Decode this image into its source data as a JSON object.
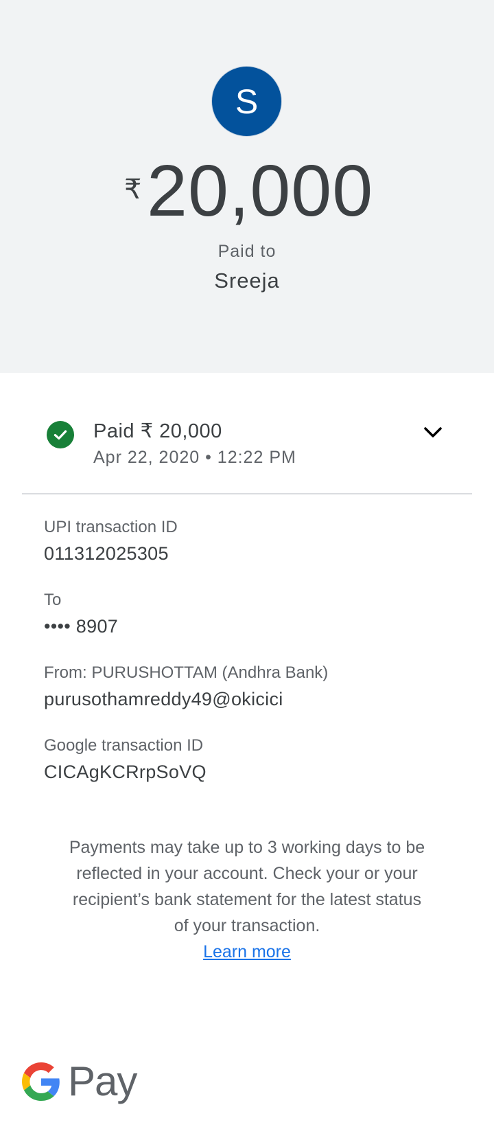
{
  "header": {
    "avatar_initial": "S",
    "currency_symbol": "₹",
    "amount": "20,000",
    "paid_to_label": "Paid to",
    "payee_name": "Sreeja"
  },
  "status": {
    "title": "Paid ₹ 20,000",
    "datetime": "Apr 22, 2020 • 12:22 PM",
    "icon": "check-circle-icon",
    "expand_icon": "chevron-down-icon"
  },
  "details": {
    "upi": {
      "label": "UPI transaction ID",
      "value": "011312025305"
    },
    "to": {
      "label": "To",
      "value": "•••• 8907"
    },
    "from": {
      "label": "From: PURUSHOTTAM (Andhra Bank)",
      "value": "purusothamreddy49@okicici"
    },
    "google": {
      "label": "Google transaction ID",
      "value": "CICAgKCRrpSoVQ"
    }
  },
  "disclaimer": {
    "text": "Payments may take up to 3 working days to be reflected in your account. Check your or your recipient’s bank statement for the latest status of your transaction.",
    "link": "Learn more"
  },
  "footer": {
    "logo_text": "Pay"
  },
  "colors": {
    "header_bg": "#f1f3f4",
    "avatar_bg": "#03529c",
    "success_green": "#188038",
    "link_blue": "#1a73e8"
  }
}
